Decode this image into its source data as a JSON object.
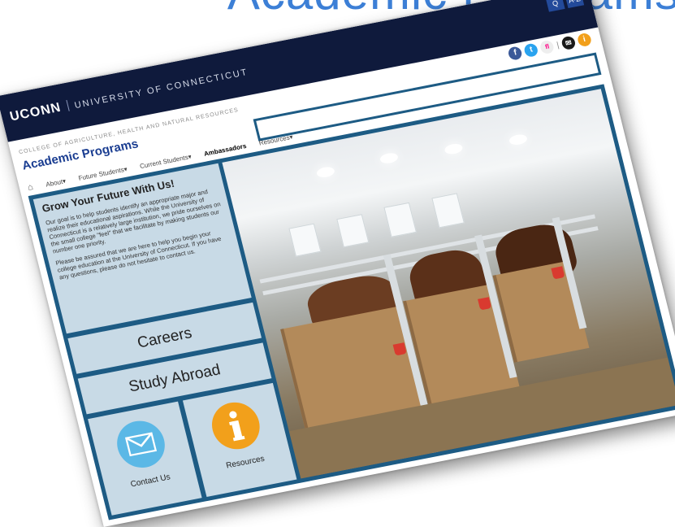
{
  "slide_title": "Academic Programs",
  "header": {
    "brand": "UCONN",
    "university": "UNIVERSITY OF CONNECTICUT",
    "search_label": "Q",
    "az_label": "A-Z"
  },
  "site": {
    "college": "COLLEGE OF AGRICULTURE, HEALTH AND NATURAL RESOURCES",
    "program": "Academic Programs"
  },
  "social": [
    "f",
    "t",
    "fl",
    "i"
  ],
  "nav": {
    "items": [
      {
        "label": "About"
      },
      {
        "label": "Future Students"
      },
      {
        "label": "Current Students"
      },
      {
        "label": "Ambassadors"
      },
      {
        "label": "Resources"
      }
    ]
  },
  "intro": {
    "heading": "Grow Your Future With Us!",
    "p1": "Our goal is to help students identify an appropriate major and realize their educational aspirations. While the University of Connecticut is a relatively large institution, we pride ourselves on the small college \"feel\" that we facilitate by making students our number one priority.",
    "p2": "Please be assured that we are here to help you begin your college education at the University of Connecticut. If you have any questions, please do not hesitate to contact us."
  },
  "buttons": {
    "careers": "Careers",
    "study_abroad": "Study Abroad"
  },
  "tiles": [
    {
      "label": "Contact Us",
      "icon": "envelope-icon",
      "color": "#5bb8e6"
    },
    {
      "label": "Resources",
      "icon": "info-icon",
      "color": "#f2a01b"
    }
  ],
  "colors": {
    "navy": "#0f1a3c",
    "frame": "#1d5b84",
    "panel": "#c8dae6",
    "title_blue": "#3c7fd6"
  }
}
